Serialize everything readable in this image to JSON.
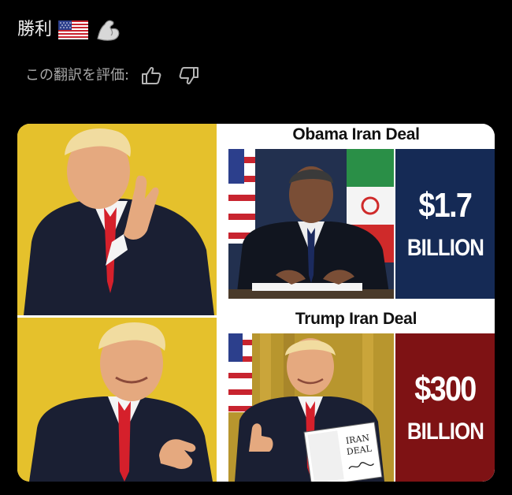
{
  "post": {
    "text": "勝利",
    "emojis": [
      "flag-usa-icon",
      "flexed-biceps-icon"
    ]
  },
  "translation": {
    "rate_label": "この翻訳を評価:",
    "icons": [
      "thumbs-up-icon",
      "thumbs-down-icon"
    ]
  },
  "meme": {
    "top_heading": "Obama Iran Deal",
    "top_amount": "$1.7",
    "top_unit": "BILLION",
    "bottom_heading": "Trump Iran Deal",
    "bottom_amount": "$300",
    "bottom_unit": "BILLION",
    "document_text_1": "IRAN",
    "document_text_2": "DEAL",
    "colors": {
      "yellow_bg": "#e5c12c",
      "navy_box": "#152a55",
      "red_box": "#7e1214"
    }
  }
}
